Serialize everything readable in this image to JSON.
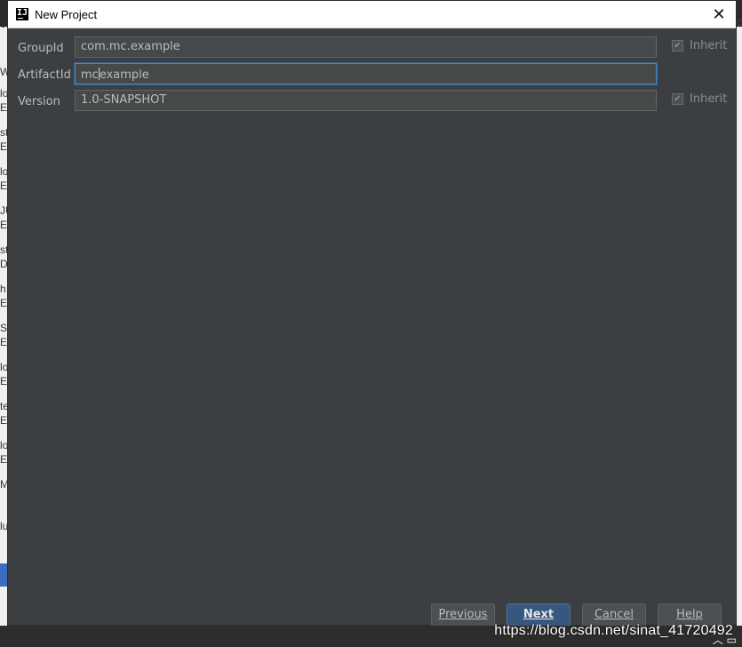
{
  "window": {
    "title": "New Project",
    "close_glyph": "✕"
  },
  "form": {
    "group_id": {
      "label": "GroupId",
      "value": "com.mc.example",
      "inherit_label": "Inherit",
      "inherit_checked": true
    },
    "artifact_id": {
      "label": "ArtifactId",
      "value_before_caret": "mc",
      "value_after_caret": "example"
    },
    "version": {
      "label": "Version",
      "value": "1.0-SNAPSHOT",
      "inherit_label": "Inherit",
      "inherit_checked": true
    }
  },
  "buttons": {
    "previous": "Previous",
    "next": "Next",
    "cancel": "Cancel",
    "help": "Help"
  },
  "background": {
    "left_fragments": [
      "o",
      "W",
      "lo",
      "E",
      "st",
      "E",
      "lo",
      "E",
      "JU",
      "E",
      "st",
      "D",
      "h",
      "E",
      "S",
      "E",
      "lo",
      "E",
      "te",
      "E",
      "lo",
      "E",
      "M",
      "lu"
    ]
  },
  "watermark": "https://blog.csdn.net/sinat_41720492",
  "colors": {
    "dialog_bg": "#3c3f41",
    "field_bg": "#45494a",
    "focus_border": "#4a88c7",
    "default_button": "#365880"
  }
}
